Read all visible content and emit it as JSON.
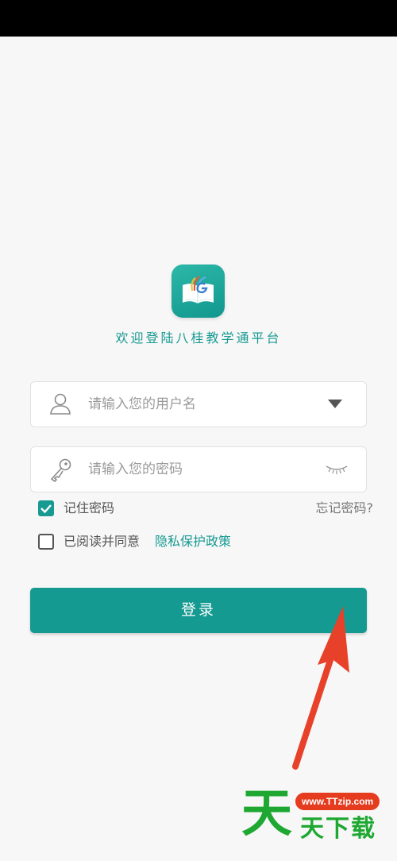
{
  "app": {
    "welcome_text": "欢迎登陆八桂教学通平台",
    "logo_icon": "book-logo-icon"
  },
  "form": {
    "username_placeholder": "请输入您的用户名",
    "password_placeholder": "请输入您的密码",
    "remember_label": "记住密码",
    "remember_checked": true,
    "forgot_label": "忘记密码?",
    "agree_label": "已阅读并同意",
    "privacy_link": "隐私保护政策",
    "agree_checked": false,
    "login_label": "登录"
  },
  "colors": {
    "accent": "#179a92",
    "button": "#149a90",
    "arrow": "#e8412a"
  },
  "watermark": {
    "big_char": "天",
    "url": "www.TTzip.com",
    "text": "天下载"
  }
}
